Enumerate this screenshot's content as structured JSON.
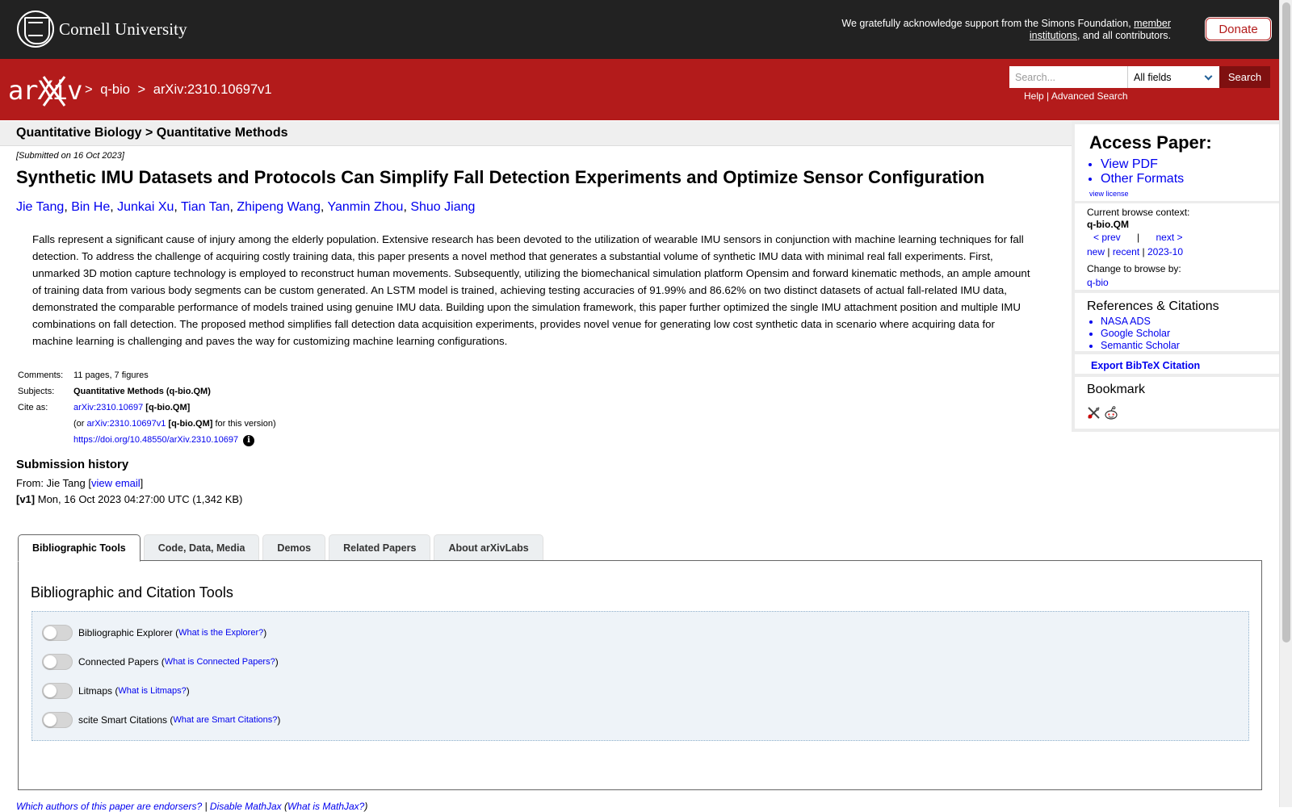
{
  "cornell": {
    "name": "Cornell University",
    "support_prefix": "We gratefully acknowledge support from the Simons Foundation, ",
    "support_link": "member institutions",
    "support_suffix": ", and all contributors.",
    "donate_label": "Donate"
  },
  "header": {
    "logo_text": "arXiv",
    "breadcrumb": [
      ">",
      "q-bio",
      ">",
      "arXiv:2310.10697v1"
    ],
    "search_placeholder": "Search...",
    "search_field": "All fields",
    "search_button": "Search",
    "help_link": "Help",
    "separator": "|",
    "advanced_link": "Advanced Search"
  },
  "subheader": {
    "title": "Quantitative Biology > Quantitative Methods"
  },
  "paper": {
    "dateline": "[Submitted on 16 Oct 2023]",
    "title": "Synthetic IMU Datasets and Protocols Can Simplify Fall Detection Experiments and Optimize Sensor Configuration",
    "authors": [
      "Jie Tang",
      "Bin He",
      "Junkai Xu",
      "Tian Tan",
      "Zhipeng Wang",
      "Yanmin Zhou",
      "Shuo Jiang"
    ],
    "abstract": "Falls represent a significant cause of injury among the elderly population. Extensive research has been devoted to the utilization of wearable IMU sensors in conjunction with machine learning techniques for fall detection. To address the challenge of acquiring costly training data, this paper presents a novel method that generates a substantial volume of synthetic IMU data with minimal real fall experiments. First, unmarked 3D motion capture technology is employed to reconstruct human movements. Subsequently, utilizing the biomechanical simulation platform Opensim and forward kinematic methods, an ample amount of training data from various body segments can be custom generated. An LSTM model is trained, achieving testing accuracies of 91.99% and 86.62% on two distinct datasets of actual fall-related IMU data, demonstrated the comparable performance of models trained using genuine IMU data. Building upon the simulation framework, this paper further optimized the single IMU attachment position and multiple IMU combinations on fall detection. The proposed method simplifies fall detection data acquisition experiments, provides novel venue for generating low cost synthetic data in scenario where acquiring data for machine learning is challenging and paves the way for customizing machine learning configurations."
  },
  "meta": {
    "comments_label": "Comments:",
    "comments_value": "11 pages, 7 figures",
    "subjects_label": "Subjects:",
    "subjects_value": "Quantitative Methods (q-bio.QM)",
    "cite_label": "Cite as:",
    "cite_id": "arXiv:2310.10697",
    "cite_cat": "[q-bio.QM]",
    "cite_or": "(or ",
    "cite_version_id": "arXiv:2310.10697v1",
    "cite_version_cat": "[q-bio.QM]",
    "cite_version_suffix": " for this version)",
    "doi": "https://doi.org/10.48550/arXiv.2310.10697"
  },
  "history": {
    "title": "Submission history",
    "from_prefix": "From: Jie Tang [",
    "email_link": "view email",
    "from_suffix": "]",
    "v1_label": "[v1]",
    "v1_text": " Mon, 16 Oct 2023 04:27:00 UTC (1,342 KB)"
  },
  "tabs": [
    {
      "label": "Bibliographic Tools",
      "active": true
    },
    {
      "label": "Code, Data, Media",
      "active": false
    },
    {
      "label": "Demos",
      "active": false
    },
    {
      "label": "Related Papers",
      "active": false
    },
    {
      "label": "About arXivLabs",
      "active": false
    }
  ],
  "panel": {
    "title": "Bibliographic and Citation Tools",
    "tools": [
      {
        "name": "Bibliographic Explorer",
        "link": "What is the Explorer?"
      },
      {
        "name": "Connected Papers",
        "link": "What is Connected Papers?"
      },
      {
        "name": "Litmaps",
        "link": "What is Litmaps?"
      },
      {
        "name": "scite Smart Citations",
        "link": "What are Smart Citations?"
      }
    ]
  },
  "bottom": {
    "endorsers": "Which authors of this paper are endorsers?",
    "sep": " | ",
    "mathjax": "Disable MathJax",
    "mathjax_what": "What is MathJax?"
  },
  "sidebar": {
    "access_title": "Access Paper:",
    "access_links": [
      "View PDF",
      "Other Formats"
    ],
    "view_license": "view license",
    "context_label": "Current browse context:",
    "context_value": "q-bio.QM",
    "prev": "< prev",
    "pipe": "|",
    "next": "next >",
    "new": "new",
    "recent": "recent",
    "month": "2023-10",
    "change_label": "Change to browse by:",
    "change_value": "q-bio",
    "refs_title": "References & Citations",
    "refs_links": [
      "NASA ADS",
      "Google Scholar",
      "Semantic Scholar"
    ],
    "bibtex": "Export BibTeX Citation",
    "bookmark_title": "Bookmark"
  },
  "colors": {
    "arxiv_red": "#b31b1b",
    "cornell_dark": "#222222",
    "link_blue": "#0000ee"
  }
}
